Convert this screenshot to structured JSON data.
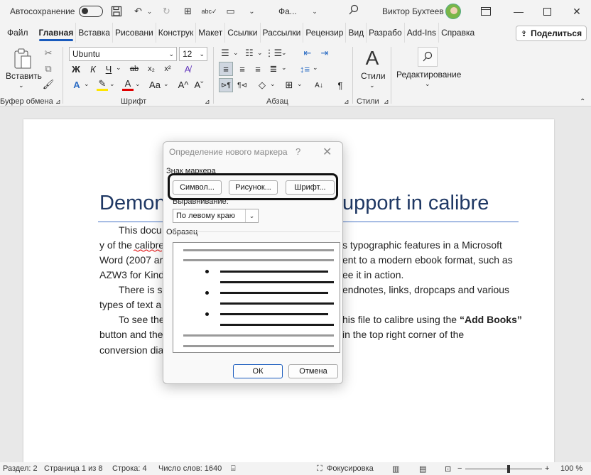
{
  "titlebar": {
    "autosave_label": "Автосохранение",
    "filename": "Фа...",
    "user_name": "Виктор Бухтеев"
  },
  "tabs": [
    "Файл",
    "Главная",
    "Вставка",
    "Рисовани",
    "Конструк",
    "Макет",
    "Ссылки",
    "Рассылки",
    "Рецензир",
    "Вид",
    "Разрабо",
    "Add-Ins",
    "Справка"
  ],
  "share_label": "Поделиться",
  "ribbon": {
    "paste_label": "Вставить",
    "font_name": "Ubuntu",
    "font_size": "12",
    "bold": "Ж",
    "italic": "К",
    "underline": "Ч",
    "styles_label": "Стили",
    "editing_label": "Редактирование",
    "groups": {
      "clipboard": "Буфер обмена",
      "font": "Шрифт",
      "paragraph": "Абзац",
      "styles": "Стили"
    }
  },
  "document": {
    "title_left": "Demon",
    "title_right": "upport in calibre",
    "lines": [
      {
        "left": "This docu",
        "right": ""
      },
      {
        "left": "y of the calibre",
        "right": "s typographic features in a Microsoft"
      },
      {
        "left": "Word (2007 ar",
        "right": "ent to a modern ebook format, such as"
      },
      {
        "left": "AZW3 for Kind",
        "right": "ee it in action."
      },
      {
        "left": "There is su",
        "right": "endnotes, links, dropcaps and various"
      },
      {
        "left": "types of text a",
        "right": ""
      },
      {
        "left": "To see the",
        "right": "his file to calibre using the"
      },
      {
        "left": "button and the",
        "right": "in the top right corner of the"
      },
      {
        "left": "conversion dia",
        "right": ""
      }
    ],
    "bold_phrase": "“Add Books”"
  },
  "dialog": {
    "title": "Определение нового маркера",
    "help": "?",
    "close": "✕",
    "marker_section": "Знак маркера",
    "symbol_button": "Символ...",
    "picture_button": "Рисунок...",
    "font_button": "Шрифт...",
    "alignment_label": "Выравнивание:",
    "alignment_value": "По левому краю",
    "sample_label": "Образец",
    "ok": "ОК",
    "cancel": "Отмена"
  },
  "statusbar": {
    "section": "Раздел: 2",
    "page": "Страница 1 из 8",
    "line": "Строка: 4",
    "words": "Число слов: 1640",
    "focus": "Фокусировка",
    "zoom": "100 %"
  },
  "colors": {
    "accent": "#185abd",
    "title_color": "#1f3864"
  }
}
